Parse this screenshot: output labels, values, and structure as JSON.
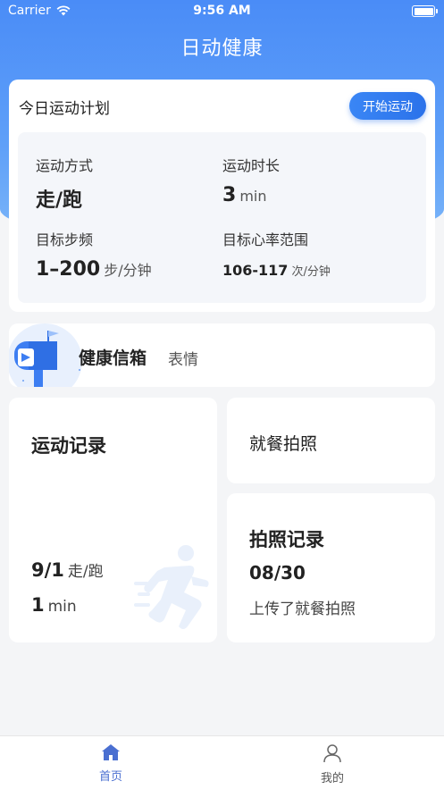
{
  "status_bar": {
    "carrier": "Carrier",
    "time": "9:56 AM"
  },
  "app_title": "日动健康",
  "plan": {
    "title": "今日运动计划",
    "start_button": "开始运动",
    "mode_label": "运动方式",
    "mode_value": "走/跑",
    "duration_label": "运动时长",
    "duration_value": "3",
    "duration_unit": "min",
    "cadence_label": "目标步频",
    "cadence_value": "1–200",
    "cadence_unit": "步/分钟",
    "heart_label": "目标心率范围",
    "heart_value": "106-117",
    "heart_unit": "次/分钟"
  },
  "mailbox": {
    "name": "健康信箱",
    "tag": "表情"
  },
  "record": {
    "title": "运动记录",
    "date": "9/1",
    "date_unit": "走/跑",
    "duration": "1",
    "duration_unit": "min"
  },
  "meal": {
    "title": "就餐拍照"
  },
  "photo": {
    "title": "拍照记录",
    "date": "08/30",
    "desc": "上传了就餐拍照"
  },
  "tabbar": {
    "home": "首页",
    "me": "我的"
  },
  "colors": {
    "primary": "#4a8cf7",
    "button": "#2b72ea",
    "tab_active": "#4a6fd1",
    "background": "#f4f5f7"
  },
  "icons": {
    "wifi": "wifi-icon",
    "battery": "battery-icon",
    "mailbox": "mailbox-icon",
    "runner": "runner-icon",
    "home": "home-icon",
    "user": "user-icon"
  }
}
